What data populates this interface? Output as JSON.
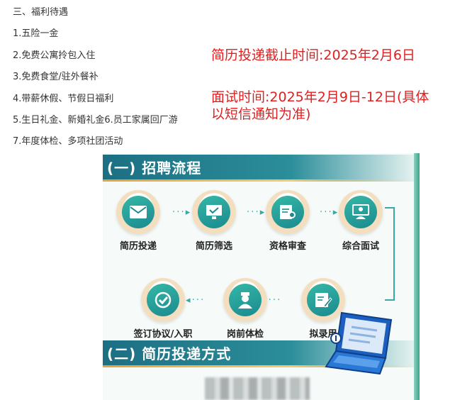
{
  "benefits": {
    "heading": "三、福利待遇",
    "items": [
      "1.五险一金",
      "2.免费公寓拎包入住",
      "3.免费食堂/驻外餐补",
      "4.带薪休假、节假日福利",
      "5.生日礼金、新婚礼金6.员工家属回厂游",
      "7.年度体检、多项社团活动"
    ]
  },
  "notice": {
    "deadline": "简历投递截止时间:2025年2月6日",
    "interview_line1": "面试时间:2025年2月9日-12日(具体",
    "interview_line2": "以短信通知为准)"
  },
  "panel": {
    "section1_title": "(一) 招聘流程",
    "section2_title": "(二) 简历投递方式",
    "steps": [
      {
        "label": "简历投递",
        "icon": "envelope-icon"
      },
      {
        "label": "简历筛选",
        "icon": "screen-check-icon"
      },
      {
        "label": "资格审查",
        "icon": "document-search-icon"
      },
      {
        "label": "综合面试",
        "icon": "interview-icon"
      },
      {
        "label": "拟录用",
        "icon": "edit-document-icon"
      },
      {
        "label": "岗前体检",
        "icon": "doctor-icon"
      },
      {
        "label": "签订协议/入职",
        "icon": "checkmark-icon"
      }
    ]
  },
  "colors": {
    "notice_red": "#e02020",
    "teal": "#1c6f83",
    "accent_gold": "#e6a23a"
  }
}
